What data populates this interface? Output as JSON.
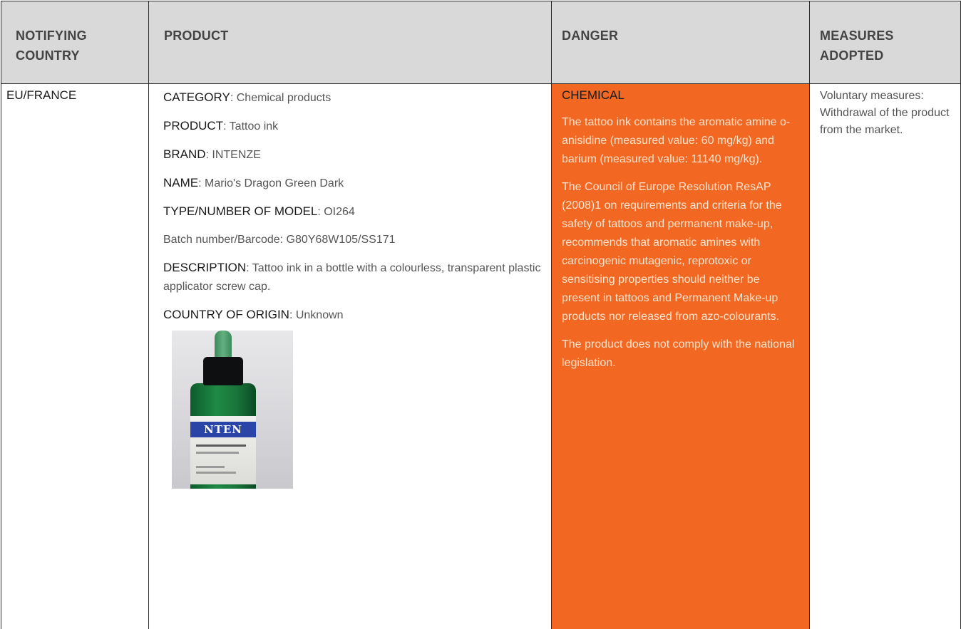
{
  "table": {
    "headers": {
      "country_line1": "NOTIFYING",
      "country_line2": "COUNTRY",
      "product": "PRODUCT",
      "danger": "DANGER",
      "measures_line1": "MEASURES",
      "measures_line2": "ADOPTED"
    },
    "row": {
      "country": "EU/FRANCE",
      "product": {
        "category_key": "CATEGORY",
        "category_value": ": Chemical products",
        "product_key": "PRODUCT",
        "product_value": ": Tattoo ink",
        "brand_key": "BRAND",
        "brand_value": ": INTENZE",
        "name_key": "NAME",
        "name_value": ": Mario's Dragon Green Dark",
        "model_key": "TYPE/NUMBER OF MODEL",
        "model_value": ": OI264",
        "batch": "Batch number/Barcode: G80Y68W105/SS171",
        "description_key": "DESCRIPTION",
        "description_value": ": Tattoo ink in a bottle with a colourless, transparent plastic applicator screw cap.",
        "origin_key": "COUNTRY OF ORIGIN",
        "origin_value": ": Unknown",
        "photo_label_text": "NTEN"
      },
      "danger": {
        "title": "CHEMICAL",
        "paragraph1": "The tattoo ink contains the aromatic amine o-anisidine (measured value: 60 mg/kg) and barium (measured value: 11140 mg/kg).",
        "paragraph2": "The Council of Europe Resolution ResAP (2008)1 on requirements and criteria for the safety of tattoos and permanent make-up, recommends that aromatic amines with carcinogenic mutagenic, reprotoxic or sensitising properties should neither be present in tattoos and Permanent Make-up products nor released from azo-colourants.",
        "paragraph3": "The product does not comply with the national legislation."
      },
      "measures": "Voluntary measures: Withdrawal of the product from the market."
    }
  },
  "colors": {
    "header_bg": "#d9d9d9",
    "danger_bg": "#f26722",
    "danger_text": "#ffe4cf",
    "border": "#2b2b2b",
    "bottle_green": "#1f8a45",
    "label_blue": "#2a44a8"
  }
}
